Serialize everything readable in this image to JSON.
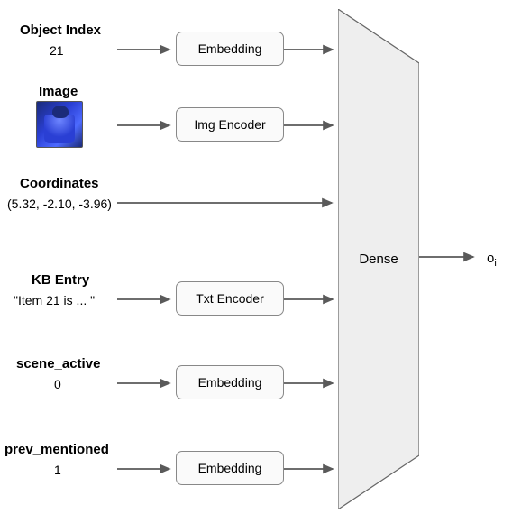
{
  "inputs": [
    {
      "label": "Object Index",
      "value": "21",
      "encoder": "Embedding",
      "has_encoder": true
    },
    {
      "label": "Image",
      "value": "",
      "encoder": "Img Encoder",
      "has_encoder": true
    },
    {
      "label": "Coordinates",
      "value": "(5.32, -2.10, -3.96)",
      "encoder": "",
      "has_encoder": false
    },
    {
      "label": "KB Entry",
      "value": "\"Item 21 is ... \"",
      "encoder": "Txt Encoder",
      "has_encoder": true
    },
    {
      "label": "scene_active",
      "value": "0",
      "encoder": "Embedding",
      "has_encoder": true
    },
    {
      "label": "prev_mentioned",
      "value": "1",
      "encoder": "Embedding",
      "has_encoder": true
    }
  ],
  "dense_label": "Dense",
  "output_label_main": "o",
  "output_label_sub": "i"
}
